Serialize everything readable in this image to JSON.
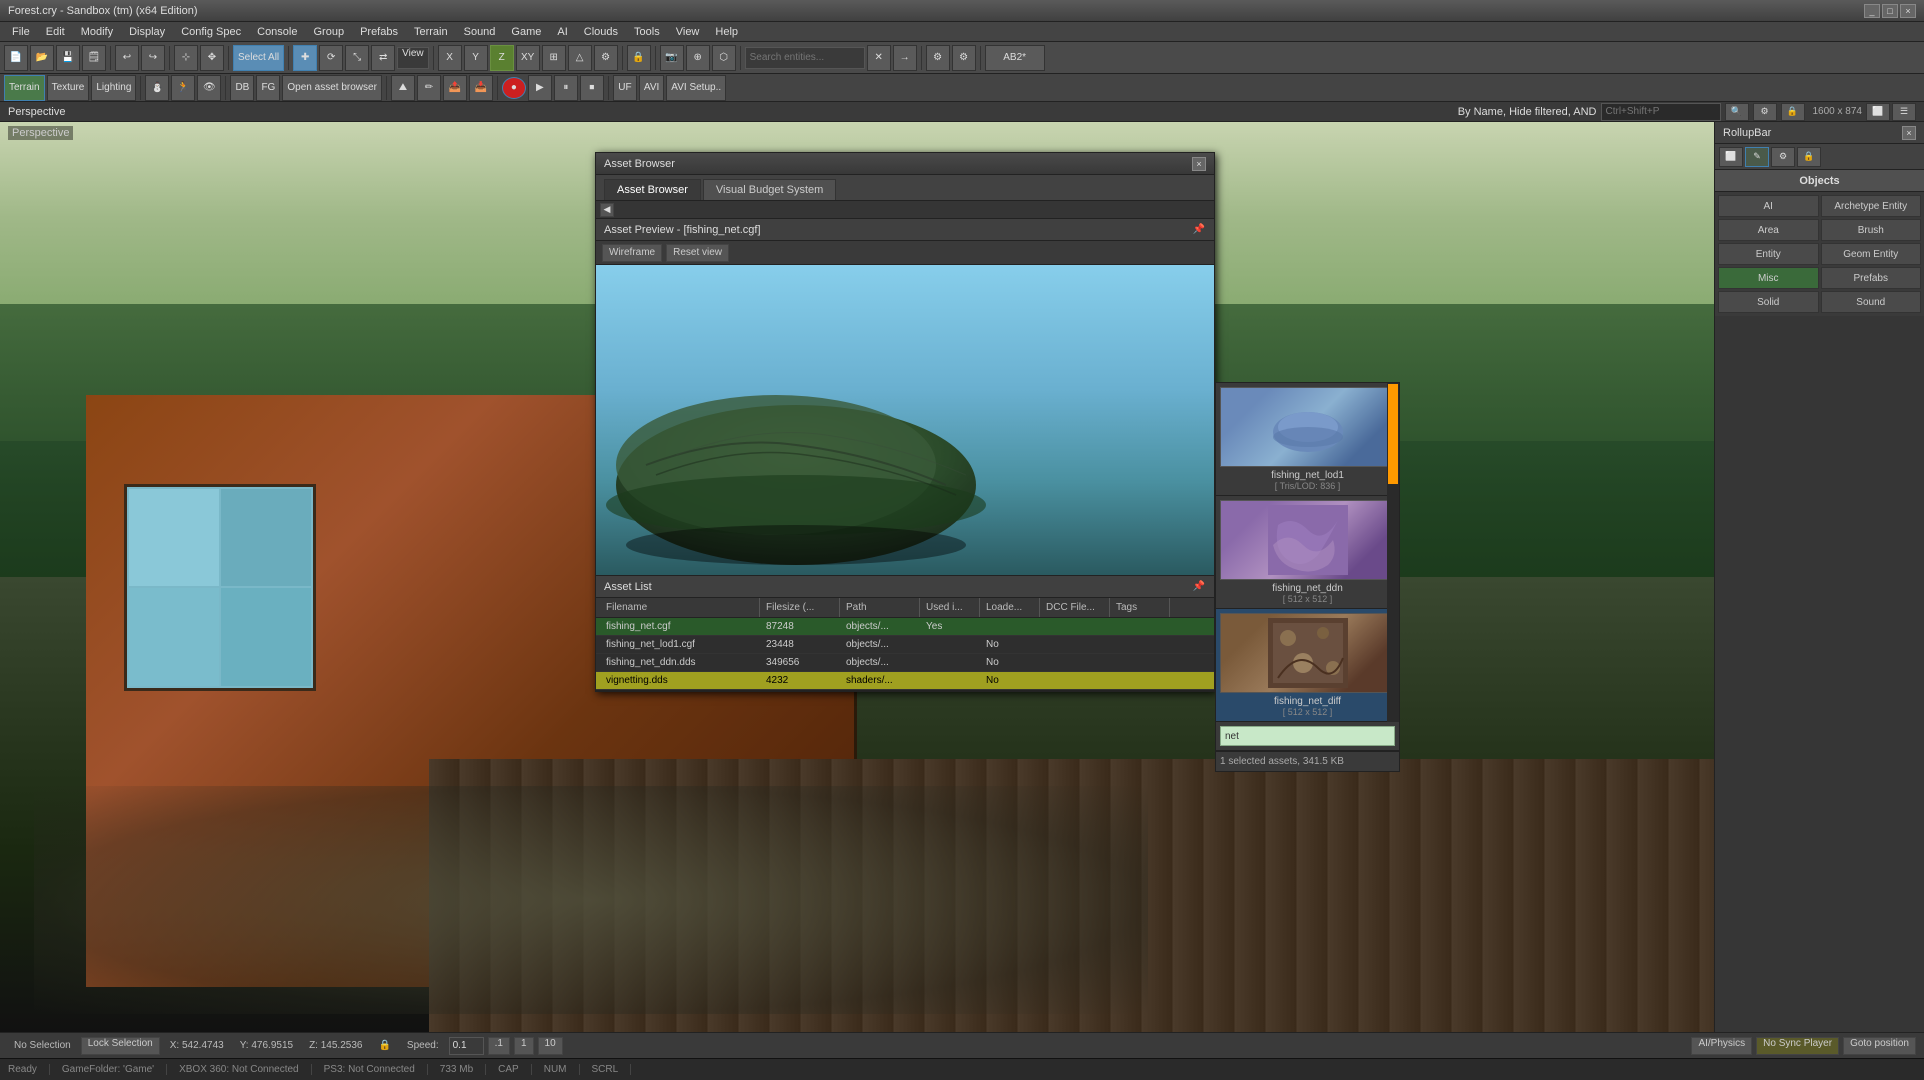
{
  "window": {
    "title": "Forest.cry - Sandbox (tm) (x64 Edition)"
  },
  "menu": {
    "items": [
      "File",
      "Edit",
      "Modify",
      "Display",
      "Config Spec",
      "Console",
      "Group",
      "Prefabs",
      "Terrain",
      "Sound",
      "Game",
      "AI",
      "Clouds",
      "Tools",
      "View",
      "Help"
    ]
  },
  "toolbar1": {
    "select_all": "Select All",
    "view_label": "View",
    "axis_labels": [
      "XY",
      "X",
      "Y",
      "Z"
    ],
    "ab2_label": "AB2*"
  },
  "toolbar2": {
    "terrain_label": "Terrain",
    "texture_label": "Texture",
    "lighting_label": "Lighting",
    "db_label": "DB",
    "fg_label": "FG",
    "open_asset_browser": "Open asset browser",
    "uf_label": "UF",
    "avi_label": "AVI",
    "avi_setup": "AVI Setup.."
  },
  "viewport": {
    "perspective_label": "Perspective",
    "search_placeholder": "Ctrl+Shift+P",
    "search_filter": "By Name, Hide filtered, AND",
    "size": "1600 x 874"
  },
  "asset_browser": {
    "title": "Asset Browser",
    "tabs": [
      {
        "label": "Asset Browser",
        "active": true
      },
      {
        "label": "Visual Budget System",
        "active": false
      }
    ],
    "preview": {
      "title": "Asset Preview - [fishing_net.cgf]",
      "wireframe_label": "Wireframe",
      "reset_view_label": "Reset view"
    },
    "asset_list": {
      "title": "Asset List",
      "columns": [
        "Filename",
        "Filesize (...",
        "Path",
        "Used i...",
        "Loade...",
        "DCC File...",
        "Tags"
      ],
      "rows": [
        {
          "filename": "fishing_net.cgf",
          "filesize": "87248",
          "path": "objects/...",
          "used": "Yes",
          "loaded": "",
          "dcc": "",
          "tags": ""
        },
        {
          "filename": "fishing_net_lod1.cgf",
          "filesize": "23448",
          "path": "objects/...",
          "used": "",
          "loaded": "No",
          "dcc": "",
          "tags": ""
        },
        {
          "filename": "fishing_net_ddn.dds",
          "filesize": "349656",
          "path": "objects/...",
          "used": "",
          "loaded": "No",
          "dcc": "",
          "tags": ""
        },
        {
          "filename": "vignetting.dds",
          "filesize": "4232",
          "path": "shaders/...",
          "used": "",
          "loaded": "No",
          "dcc": "",
          "tags": "",
          "highlighted": true
        }
      ]
    },
    "thumbnails": [
      {
        "name": "fishing_net_lod1",
        "info": "[ Tris/LOD: 836 ]",
        "color": "blue"
      },
      {
        "name": "fishing_net_ddn",
        "info": "[ 512 x 512 ]",
        "color": "purple"
      },
      {
        "name": "fishing_net_diff",
        "info": "[ 512 x 512 ]",
        "color": "brown",
        "selected": true
      }
    ],
    "search_value": "net",
    "status": "1 selected assets, 341.5 KB"
  },
  "objects_panel": {
    "title": "RollupBar",
    "objects_label": "Objects",
    "buttons": [
      {
        "label": "AI",
        "row": 1,
        "col": 1
      },
      {
        "label": "Archetype Entity",
        "row": 1,
        "col": 2
      },
      {
        "label": "Area",
        "row": 2,
        "col": 1
      },
      {
        "label": "Brush",
        "row": 2,
        "col": 2
      },
      {
        "label": "Entity",
        "row": 3,
        "col": 1
      },
      {
        "label": "Geom Entity",
        "row": 3,
        "col": 2
      },
      {
        "label": "Misc",
        "row": 4,
        "col": 1,
        "active": true
      },
      {
        "label": "Prefabs",
        "row": 4,
        "col": 2
      },
      {
        "label": "Solid",
        "row": 5,
        "col": 1
      },
      {
        "label": "Sound",
        "row": 5,
        "col": 2
      }
    ]
  },
  "status_bar": {
    "selection": "No Selection",
    "lock_selection": "Lock Selection",
    "x_coord": "X: 542.4743",
    "y_coord": "Y: 476.9515",
    "z_coord": "Z: 145.2536",
    "speed_label": "Speed:",
    "speed_value": "0.1",
    "speed_options": [
      ".1",
      "1",
      "10"
    ]
  },
  "bottom_toolbar": {
    "ai_physics": "AI/Physics",
    "no_sync": "No Sync Player",
    "sync_player": "Sync Player",
    "goto_position": "Goto position"
  },
  "footer": {
    "ready": "Ready",
    "game_folder": "GameFolder: 'Game'",
    "xbox": "XBOX 360: Not Connected",
    "ps3": "PS3: Not Connected",
    "memory": "733 Mb",
    "cap": "CAP",
    "num": "NUM",
    "scrl": "SCRL"
  }
}
